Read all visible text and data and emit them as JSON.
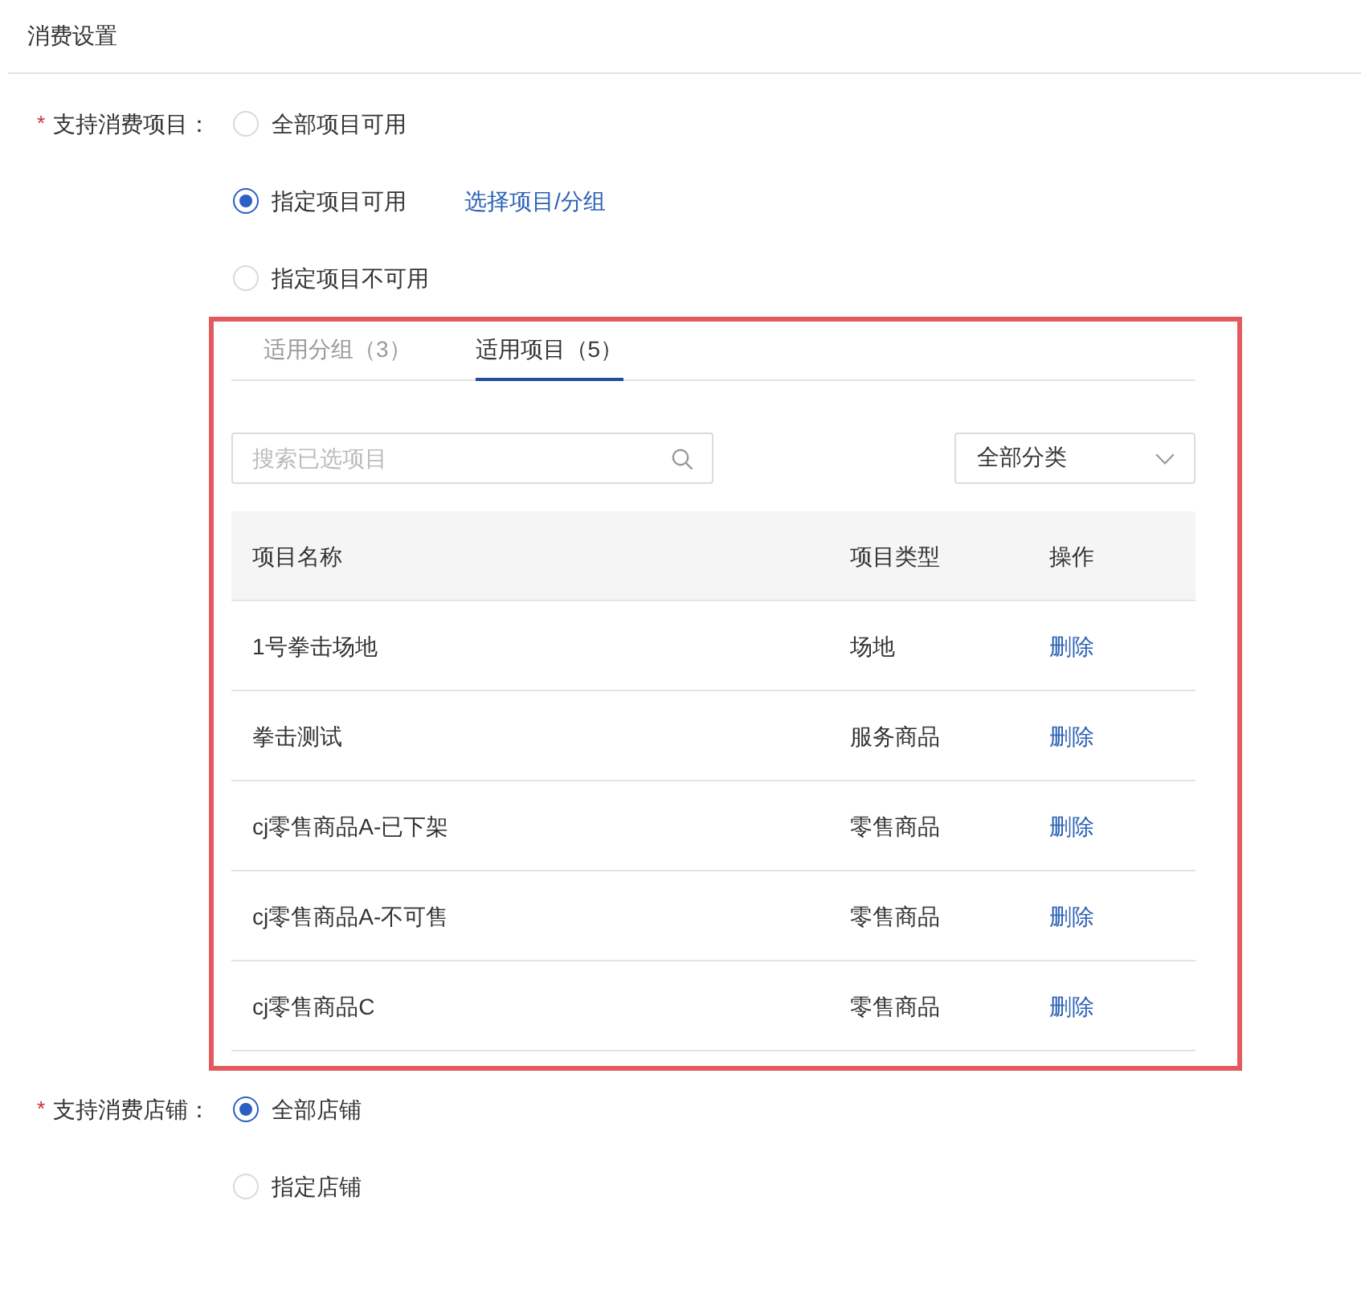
{
  "section": {
    "title": "消费设置"
  },
  "fields": [
    {
      "required_mark": "*",
      "label": "支持消费项目：",
      "options": [
        {
          "label": "全部项目可用",
          "selected": false
        },
        {
          "label": "指定项目可用",
          "selected": true,
          "link": "选择项目/分组"
        },
        {
          "label": "指定项目不可用",
          "selected": false
        }
      ],
      "panel": {
        "highlighted": true,
        "tabs": [
          {
            "label": "适用分组（3）",
            "selected": false
          },
          {
            "label": "适用项目（5）",
            "selected": true
          }
        ],
        "search": {
          "placeholder": "搜索已选项目"
        },
        "filter": {
          "value": "全部分类"
        },
        "table": {
          "columns": [
            "项目名称",
            "项目类型",
            "操作"
          ],
          "rows": [
            {
              "name": "1号拳击场地",
              "type": "场地",
              "action": "删除"
            },
            {
              "name": "拳击测试",
              "type": "服务商品",
              "action": "删除"
            },
            {
              "name": "cj零售商品A-已下架",
              "type": "零售商品",
              "action": "删除"
            },
            {
              "name": "cj零售商品A-不可售",
              "type": "零售商品",
              "action": "删除"
            },
            {
              "name": "cj零售商品C",
              "type": "零售商品",
              "action": "删除"
            }
          ]
        }
      }
    },
    {
      "required_mark": "*",
      "label": "支持消费店铺：",
      "options": [
        {
          "label": "全部店铺",
          "selected": true
        },
        {
          "label": "指定店铺",
          "selected": false
        }
      ]
    }
  ]
}
